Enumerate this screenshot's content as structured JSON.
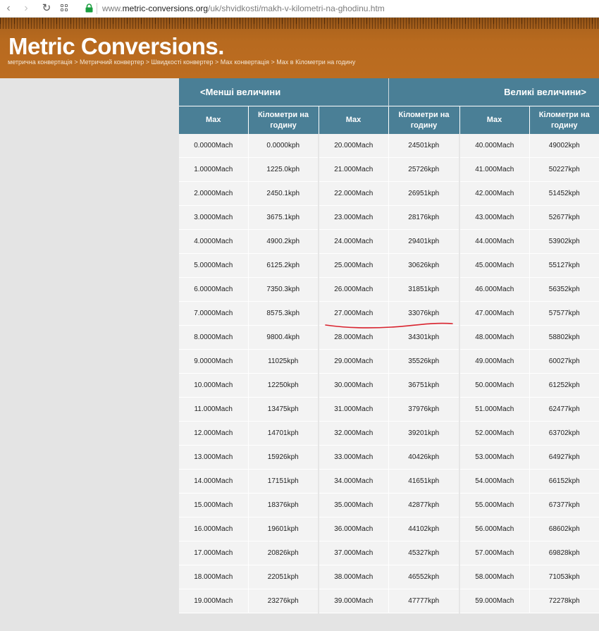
{
  "browser": {
    "url_prefix": "www.",
    "url_domain": "metric-conversions.org",
    "url_path": "/uk/shvidkosti/makh-v-kilometri-na-ghodinu.htm",
    "icons": [
      "back-arrow-icon",
      "forward-arrow-icon",
      "reload-icon",
      "apps-grid-icon",
      "lock-icon"
    ]
  },
  "header": {
    "logo": "Metric Conversions.",
    "breadcrumb": "метрична конвертація > Метричний конвертер > Швидкості конвертер > Мах конвертація > Мах в Кілометри на годину"
  },
  "table": {
    "smaller_label": "<Менші величини",
    "larger_label": "Великі величини>",
    "col_from": "Мах",
    "col_to": "Кілометри на годину",
    "rows": [
      [
        "0.0000Mach",
        "0.0000kph",
        "20.000Mach",
        "24501kph",
        "40.000Mach",
        "49002kph"
      ],
      [
        "1.0000Mach",
        "1225.0kph",
        "21.000Mach",
        "25726kph",
        "41.000Mach",
        "50227kph"
      ],
      [
        "2.0000Mach",
        "2450.1kph",
        "22.000Mach",
        "26951kph",
        "42.000Mach",
        "51452kph"
      ],
      [
        "3.0000Mach",
        "3675.1kph",
        "23.000Mach",
        "28176kph",
        "43.000Mach",
        "52677kph"
      ],
      [
        "4.0000Mach",
        "4900.2kph",
        "24.000Mach",
        "29401kph",
        "44.000Mach",
        "53902kph"
      ],
      [
        "5.0000Mach",
        "6125.2kph",
        "25.000Mach",
        "30626kph",
        "45.000Mach",
        "55127kph"
      ],
      [
        "6.0000Mach",
        "7350.3kph",
        "26.000Mach",
        "31851kph",
        "46.000Mach",
        "56352kph"
      ],
      [
        "7.0000Mach",
        "8575.3kph",
        "27.000Mach",
        "33076kph",
        "47.000Mach",
        "57577kph"
      ],
      [
        "8.0000Mach",
        "9800.4kph",
        "28.000Mach",
        "34301kph",
        "48.000Mach",
        "58802kph"
      ],
      [
        "9.0000Mach",
        "11025kph",
        "29.000Mach",
        "35526kph",
        "49.000Mach",
        "60027kph"
      ],
      [
        "10.000Mach",
        "12250kph",
        "30.000Mach",
        "36751kph",
        "50.000Mach",
        "61252kph"
      ],
      [
        "11.000Mach",
        "13475kph",
        "31.000Mach",
        "37976kph",
        "51.000Mach",
        "62477kph"
      ],
      [
        "12.000Mach",
        "14701kph",
        "32.000Mach",
        "39201kph",
        "52.000Mach",
        "63702kph"
      ],
      [
        "13.000Mach",
        "15926kph",
        "33.000Mach",
        "40426kph",
        "53.000Mach",
        "64927kph"
      ],
      [
        "14.000Mach",
        "17151kph",
        "34.000Mach",
        "41651kph",
        "54.000Mach",
        "66152kph"
      ],
      [
        "15.000Mach",
        "18376kph",
        "35.000Mach",
        "42877kph",
        "55.000Mach",
        "67377kph"
      ],
      [
        "16.000Mach",
        "19601kph",
        "36.000Mach",
        "44102kph",
        "56.000Mach",
        "68602kph"
      ],
      [
        "17.000Mach",
        "20826kph",
        "37.000Mach",
        "45327kph",
        "57.000Mach",
        "69828kph"
      ],
      [
        "18.000Mach",
        "22051kph",
        "38.000Mach",
        "46552kph",
        "58.000Mach",
        "71053kph"
      ],
      [
        "19.000Mach",
        "23276kph",
        "39.000Mach",
        "47777kph",
        "59.000Mach",
        "72278kph"
      ]
    ]
  },
  "colors": {
    "header_brown": "#b86a1f",
    "table_header_teal": "#4a7f96",
    "annotation_red": "#d9232e"
  }
}
